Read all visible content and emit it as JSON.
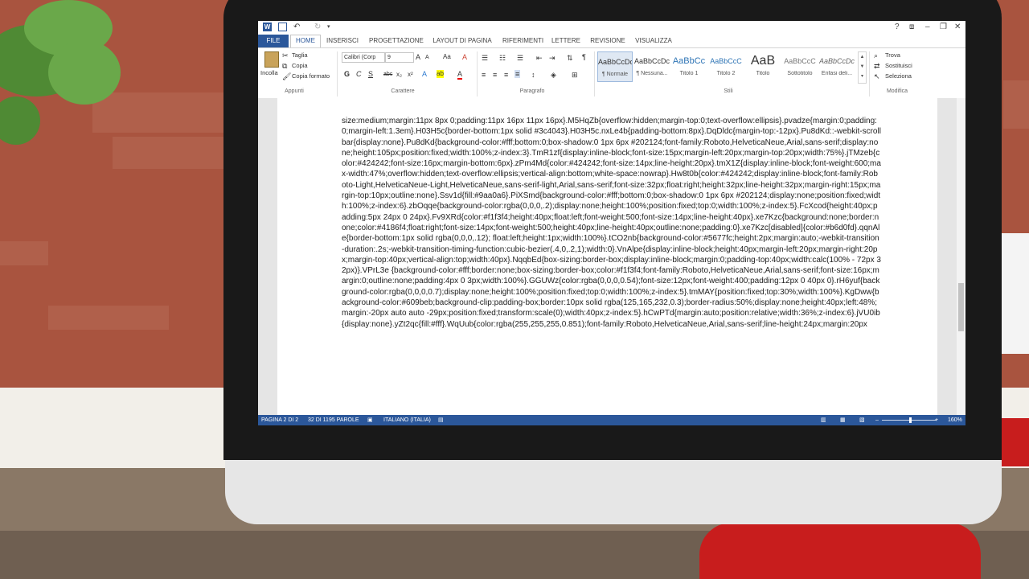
{
  "titlebar": {
    "app_icon": "W",
    "save_icon": "floppy-disk-icon",
    "undo_icon": "↶",
    "redo_icon": "↻",
    "qat_icon": "▾",
    "help": "?",
    "restore_ribbon": "⧈",
    "minimize": "–",
    "maximize": "❐",
    "close": "✕"
  },
  "tabs": [
    "FILE",
    "HOME",
    "INSERISCI",
    "PROGETTAZIONE",
    "LAYOUT DI PAGINA",
    "RIFERIMENTI",
    "LETTERE",
    "REVISIONE",
    "VISUALIZZA"
  ],
  "ribbon": {
    "clipboard": {
      "paste": "Incolla",
      "cut": "Taglia",
      "copy": "Copia",
      "format_painter": "Copia formato",
      "group_label": "Appunti"
    },
    "font": {
      "font_name": "Calibri (Corp",
      "font_size": "9",
      "grow": "A",
      "shrink": "A",
      "case": "Aa",
      "clear": "A",
      "bold": "G",
      "italic": "C",
      "underline": "S",
      "strike": "abc",
      "subscript": "x₂",
      "superscript": "x²",
      "effects": "A",
      "highlight": "ab",
      "color": "A",
      "group_label": "Carattere"
    },
    "paragraph": {
      "group_label": "Paragrafo"
    },
    "styles": {
      "items": [
        {
          "sample": "AaBbCcDc",
          "name": "¶ Normale"
        },
        {
          "sample": "AaBbCcDc",
          "name": "¶ Nessuna..."
        },
        {
          "sample": "AaBbCc",
          "name": "Titolo 1"
        },
        {
          "sample": "AaBbCcC",
          "name": "Titolo 2"
        },
        {
          "sample": "AaB",
          "name": "Titolo"
        },
        {
          "sample": "AaBbCcC",
          "name": "Sottotitolo"
        },
        {
          "sample": "AaBbCcDc",
          "name": "Enfasi deli..."
        }
      ],
      "group_label": "Stili"
    },
    "editing": {
      "find": "Trova",
      "replace": "Sostituisci",
      "select": "Seleziona",
      "group_label": "Modifica"
    }
  },
  "document": {
    "text": "size:medium;margin:11px 8px 0;padding:11px 16px 11px 16px}.M5HqZb{overflow:hidden;margin-top:0;text-overflow:ellipsis}.pvadze{margin:0;padding:0;margin-left:1.3em}.H03H5c{border-bottom:1px solid #3c4043}.H03H5c.nxLe4b{padding-bottom:8px}.DqDldc{margin-top:-12px}.Pu8dKd::-webkit-scrollbar{display:none}.Pu8dKd{background-color:#fff;bottom:0;box-shadow:0 1px 6px #202124;font-family:Roboto,HelveticaNeue,Arial,sans-serif;display:none;height:105px;position:fixed;width:100%;z-index:3}.TmR1zf{display:inline-block;font-size:15px;margin-left:20px;margin-top:20px;width:75%}.jTMzeb{color:#424242;font-size:16px;margin-bottom:6px}.zPm4Md{color:#424242;font-size:14px;line-height:20px}.tmX1Z{display:inline-block;font-weight:600;max-width:47%;overflow:hidden;text-overflow:ellipsis;vertical-align:bottom;white-space:nowrap}.Hw8t0b{color:#424242;display:inline-block;font-family:Roboto-Light,HelveticaNeue-Light,HelveticaNeue,sans-serif-light,Arial,sans-serif;font-size:32px;float:right;height:32px;line-height:32px;margin-right:15px;margin-top:10px;outline:none}.Ssv1d{fill:#9aa0a6}.PiXSmd{background-color:#fff;bottom:0;box-shadow:0 1px 6px #202124;display:none;position:fixed;width:100%;z-index:6}.zbOqqe{background-color:rgba(0,0,0,.2);display:none;height:100%;position:fixed;top:0;width:100%;z-index:5}.FcXcod{height:40px;padding:5px 24px 0 24px}.Fv9XRd{color:#f1f3f4;height:40px;float:left;font-weight:500;font-size:14px;line-height:40px}.xe7Kzc{background:none;border:none;color:#4186f4;float:right;font-size:14px;font-weight:500;height:40px;line-height:40px;outline:none;padding:0}.xe7Kzc[disabled]{color:#b6d0fd}.qqnAle{border-bottom:1px solid rgba(0,0,0,.12); float:left;height:1px;width:100%}.tCO2nb{background-color:#5677fc;height:2px;margin:auto;-webkit-transition-duration:.2s;-webkit-transition-timing-function:cubic-bezier(.4,0,.2,1);width:0}.VnAlpe{display:inline-block;height:40px;margin-left:20px;margin-right:20px;margin-top:40px;vertical-align:top;width:40px}.NqqbEd{box-sizing:border-box;display:inline-block;margin:0;padding-top:40px;width:calc(100% - 72px 32px)}.VPrL3e {background-color:#fff;border:none;box-sizing:border-box;color:#f1f3f4;font-family:Roboto,HelveticaNeue,Arial,sans-serif;font-size:16px;margin:0;outline:none;padding:4px 0 3px;width:100%}.GGUWz{color:rgba(0,0,0,0.54);font-size:12px;font-weight:400;padding:12px 0 40px 0}.rH6yuf{background-color:rgba(0,0,0,0.7);display:none;height:100%;position:fixed;top:0;width:100%;z-index:5}.tmMAY{position:fixed;top:30%;width:100%}.KgDww{background-color:#609beb;background-clip:padding-box;border:10px solid rgba(125,165,232,0.3);border-radius:50%;display:none;height:40px;left:48%;margin:-20px auto auto -29px;position:fixed;transform:scale(0);width:40px;z-index:5}.hCwPTd{margin:auto;position:relative;width:36%;z-index:6}.jVU0ib{display:none}.yZt2qc{fill:#fff}.WqUub{color:rgba(255,255,255,0.851);font-family:Roboto,HelveticaNeue,Arial,sans-serif;line-height:24px;margin:20px"
  },
  "status": {
    "page": "PAGINA 2 DI 2",
    "words": "32 DI 1195 PAROLE",
    "language": "ITALIANO (ITALIA)",
    "zoom": "160%"
  },
  "colors": {
    "accent": "#2b579a",
    "wall": "#a9543f",
    "chair": "#c81d1d"
  }
}
